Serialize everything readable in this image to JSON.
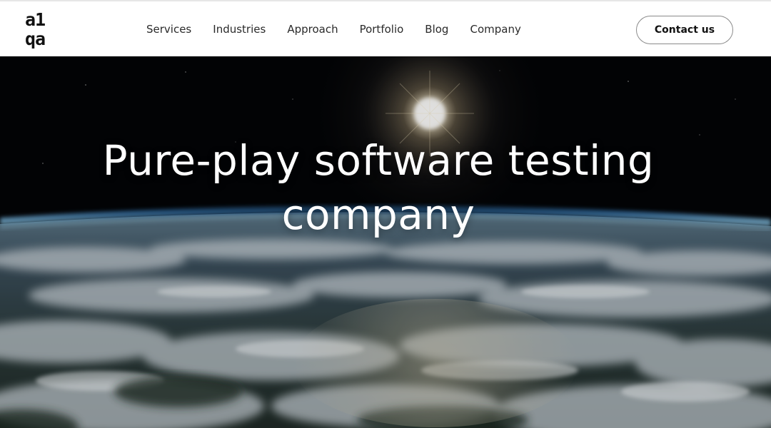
{
  "header": {
    "logo": {
      "line1": "a1",
      "line2": "qa"
    },
    "nav": [
      "Services",
      "Industries",
      "Approach",
      "Portfolio",
      "Blog",
      "Company"
    ],
    "contact_label": "Contact us"
  },
  "hero": {
    "title_line1": "Pure-play software testing",
    "title_line2": "company",
    "background": "earth-from-space-image"
  },
  "colors": {
    "header_bg": "#ffffff",
    "text_dark": "#111111",
    "hero_text": "#ffffff",
    "atmosphere": "#3f8fd0"
  }
}
